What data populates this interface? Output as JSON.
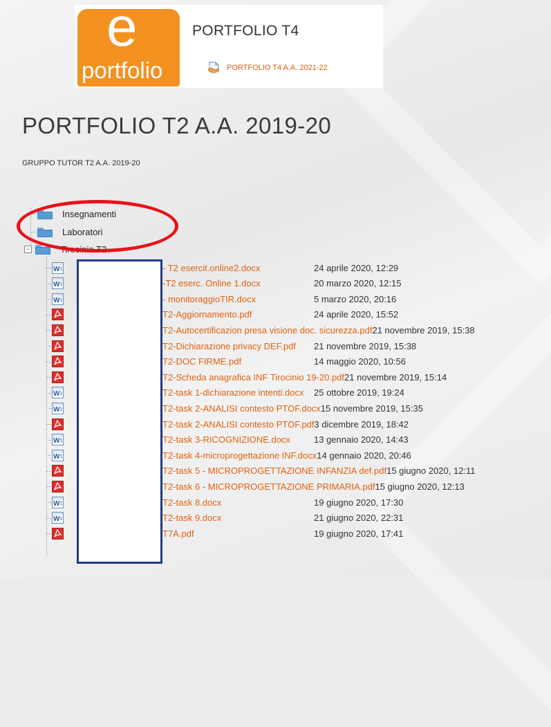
{
  "header": {
    "logo_letter": "e",
    "logo_word": "portfolio",
    "title": "PORTFOLIO T4",
    "link": "PORTFOLIO T4 A.A. 2021-22"
  },
  "page": {
    "title": "PORTFOLIO T2 A.A. 2019-20",
    "group": "GRUPPO TUTOR T2 A.A. 2019-20"
  },
  "tree": {
    "folders": [
      "Insegnamenti",
      "Laboratori",
      "Tirocinio T2"
    ],
    "expand_symbol": "−"
  },
  "files": [
    {
      "type": "word",
      "name": "- T2 esercit.online2.docx",
      "date": "24 aprile 2020, 12:29"
    },
    {
      "type": "word",
      "name": "-T2 eserc. Online 1.docx",
      "date": "20 marzo 2020, 12:15"
    },
    {
      "type": "word",
      "name": "- monitoraggioTIR.docx",
      "date": "5 marzo 2020, 20:16"
    },
    {
      "type": "pdf",
      "name": "T2-Aggiornamento.pdf",
      "date": "24 aprile 2020, 15:52"
    },
    {
      "type": "pdf",
      "name": "T2-Autocertificazion presa visione doc. sicurezza.pdf",
      "date": "21 novembre 2019, 15:38"
    },
    {
      "type": "pdf",
      "name": "T2-Dichiarazione privacy DEF.pdf",
      "date": "21 novembre 2019, 15:38"
    },
    {
      "type": "pdf",
      "name": "T2-DOC FIRME.pdf",
      "date": "14 maggio 2020, 10:56"
    },
    {
      "type": "pdf",
      "name": "T2-Scheda anagrafica INF Tirocinio 19-20.pdf",
      "date": "21 novembre 2019, 15:14"
    },
    {
      "type": "word",
      "name": "T2-task 1-dichiarazione intenti.docx",
      "date": "25 ottobre 2019, 19:24"
    },
    {
      "type": "word",
      "name": "T2-task 2-ANALISI contesto PTOF.docx",
      "date": "15 novembre 2019, 15:35"
    },
    {
      "type": "pdf",
      "name": "T2-task 2-ANALISI contesto PTOF.pdf",
      "date": "3 dicembre 2019, 18:42"
    },
    {
      "type": "word",
      "name": "T2-task 3-RICOGNIZIONE.docx",
      "date": "13 gennaio 2020, 14:43"
    },
    {
      "type": "word",
      "name": "T2-task 4-microprogettazione INF.docx",
      "date": "14 gennaio 2020, 20:46"
    },
    {
      "type": "pdf",
      "name": "T2-task 5 - MICROPROGETTAZIONE INFANZIA def.pdf",
      "date": "15 giugno 2020, 12:11"
    },
    {
      "type": "pdf",
      "name": "T2-task 6 - MICROPROGETTAZIONE PRIMARIA.pdf",
      "date": "15 giugno 2020, 12:13"
    },
    {
      "type": "word",
      "name": "T2-task 8.docx",
      "date": "19 giugno 2020, 17:30"
    },
    {
      "type": "word",
      "name": "T2-task 9.docx",
      "date": "21 giugno 2020, 22:31"
    },
    {
      "type": "pdf",
      "name": "T7A.pdf",
      "date": "19 giugno 2020, 17:41"
    }
  ],
  "colors": {
    "accent": "#e0620e",
    "logo": "#f39121",
    "highlight_ellipse": "#e8121a",
    "redaction_border": "#1f3b84"
  }
}
